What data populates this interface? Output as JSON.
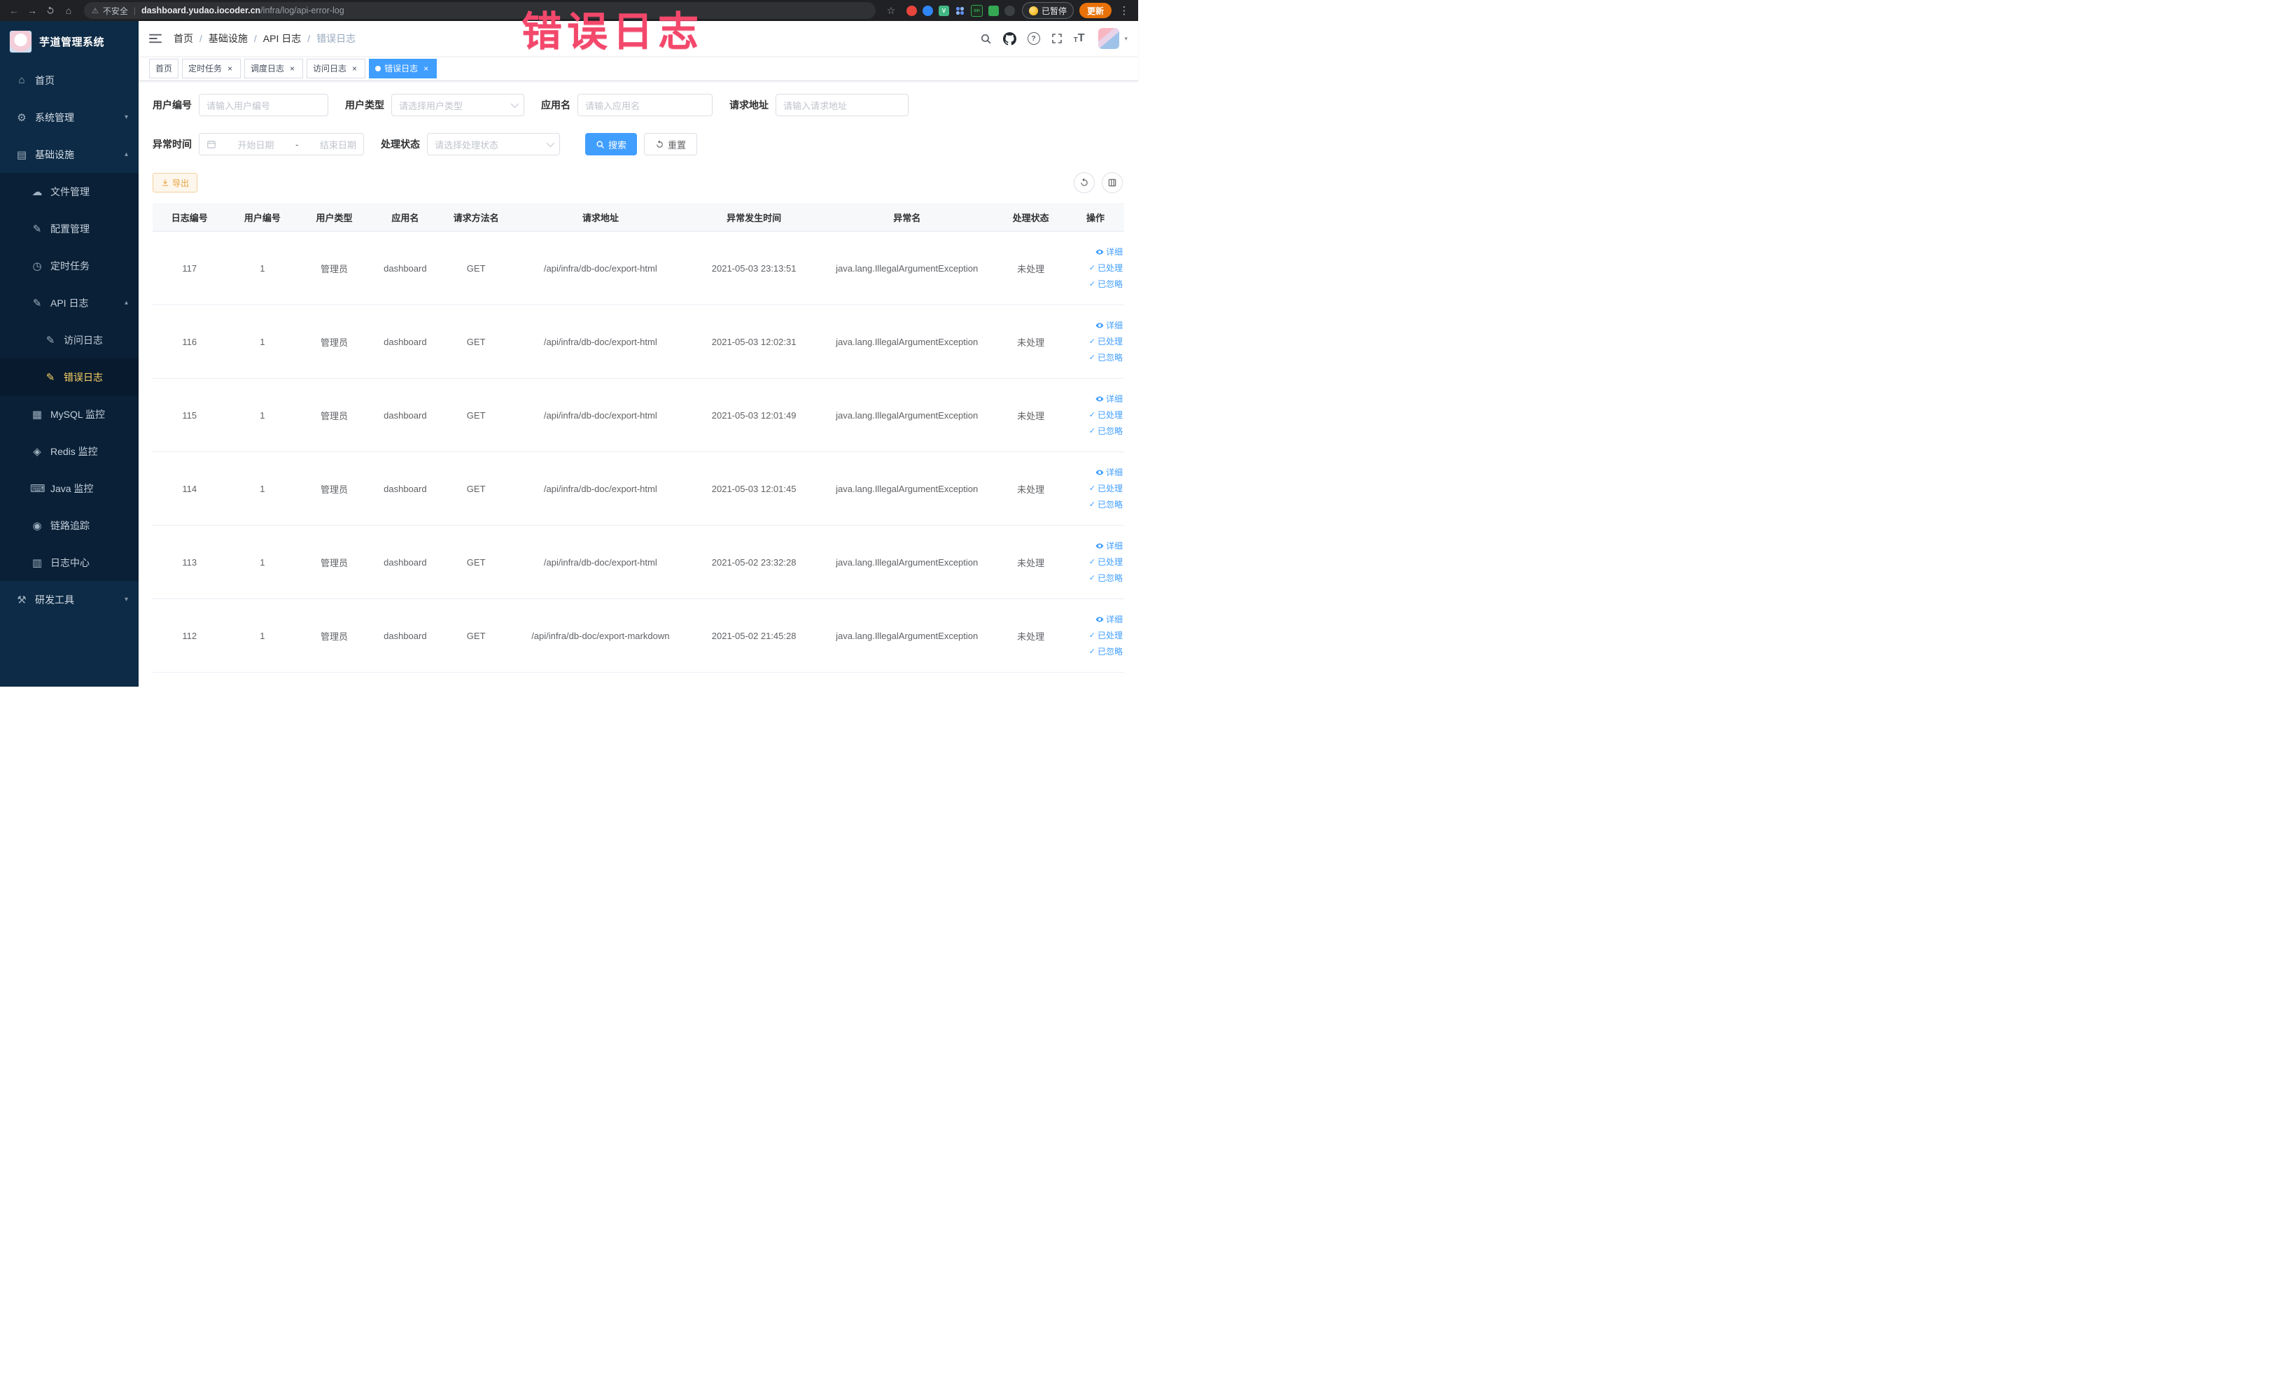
{
  "browser": {
    "security_label": "不安全",
    "url_domain": "dashboard.yudao.iocoder.cn",
    "url_path": "/infra/log/api-error-log",
    "paused_label": "已暂停",
    "update_label": "更新"
  },
  "watermark": "错误日志",
  "sidebar": {
    "logo_title": "芋道管理系统",
    "items": [
      {
        "key": "home",
        "label": "首页",
        "icon": "home-icon",
        "level": 1,
        "type": "item"
      },
      {
        "key": "system-management",
        "label": "系统管理",
        "icon": "gear-icon",
        "level": 1,
        "type": "submenu",
        "state": "collapsed"
      },
      {
        "key": "infrastructure",
        "label": "基础设施",
        "icon": "infra-icon",
        "level": 1,
        "type": "submenu",
        "state": "expanded"
      },
      {
        "key": "file-management",
        "label": "文件管理",
        "icon": "file-manage-icon",
        "level": 2,
        "type": "item"
      },
      {
        "key": "config-management",
        "label": "配置管理",
        "icon": "config-icon",
        "level": 2,
        "type": "item"
      },
      {
        "key": "scheduled-tasks",
        "label": "定时任务",
        "icon": "cron-icon",
        "level": 2,
        "type": "item"
      },
      {
        "key": "api-log",
        "label": "API 日志",
        "icon": "api-log-icon",
        "level": 2,
        "type": "submenu",
        "state": "expanded"
      },
      {
        "key": "access-log",
        "label": "访问日志",
        "icon": "access-log-icon",
        "level": 3,
        "type": "item"
      },
      {
        "key": "error-log",
        "label": "错误日志",
        "icon": "error-log-icon",
        "level": 3,
        "type": "item",
        "active": true
      },
      {
        "key": "mysql-monitor",
        "label": "MySQL 监控",
        "icon": "mysql-icon",
        "level": 2,
        "type": "item"
      },
      {
        "key": "redis-monitor",
        "label": "Redis 监控",
        "icon": "redis-icon",
        "level": 2,
        "type": "item"
      },
      {
        "key": "java-monitor",
        "label": "Java 监控",
        "icon": "java-icon",
        "level": 2,
        "type": "item"
      },
      {
        "key": "link-trace",
        "label": "链路追踪",
        "icon": "trace-icon",
        "level": 2,
        "type": "item"
      },
      {
        "key": "log-center",
        "label": "日志中心",
        "icon": "log-center-icon",
        "level": 2,
        "type": "item"
      },
      {
        "key": "dev-tools",
        "label": "研发工具",
        "icon": "devtools-icon",
        "level": 1,
        "type": "submenu",
        "state": "collapsed"
      }
    ]
  },
  "navbar": {
    "breadcrumb": [
      "首页",
      "基础设施",
      "API 日志",
      "错误日志"
    ]
  },
  "tabs": [
    {
      "key": "home",
      "label": "首页",
      "closable": false,
      "active": false
    },
    {
      "key": "scheduled-tasks",
      "label": "定时任务",
      "closable": true,
      "active": false
    },
    {
      "key": "schedule-log",
      "label": "调度日志",
      "closable": true,
      "active": false
    },
    {
      "key": "access-log",
      "label": "访问日志",
      "closable": true,
      "active": false
    },
    {
      "key": "error-log",
      "label": "错误日志",
      "closable": true,
      "active": true
    }
  ],
  "filters": {
    "user_id": {
      "label": "用户编号",
      "placeholder": "请输入用户编号",
      "value": ""
    },
    "user_type": {
      "label": "用户类型",
      "placeholder": "请选择用户类型",
      "value": ""
    },
    "app_name": {
      "label": "应用名",
      "placeholder": "请输入应用名",
      "value": ""
    },
    "request_url": {
      "label": "请求地址",
      "placeholder": "请输入请求地址",
      "value": ""
    },
    "exception_time": {
      "label": "异常时间",
      "start_placeholder": "开始日期",
      "separator": "-",
      "end_placeholder": "结束日期"
    },
    "process_status": {
      "label": "处理状态",
      "placeholder": "请选择处理状态",
      "value": ""
    },
    "search_label": "搜索",
    "reset_label": "重置"
  },
  "toolbar": {
    "export_label": "导出"
  },
  "table": {
    "columns": [
      "日志编号",
      "用户编号",
      "用户类型",
      "应用名",
      "请求方法名",
      "请求地址",
      "异常发生时间",
      "异常名",
      "处理状态",
      "操作"
    ],
    "action_labels": {
      "detail": "详细",
      "processed": "已处理",
      "ignored": "已忽略"
    },
    "rows": [
      {
        "id": "117",
        "user_id": "1",
        "user_type": "管理员",
        "app": "dashboard",
        "method": "GET",
        "url": "/api/infra/db-doc/export-html",
        "time": "2021-05-03 23:13:51",
        "exception": "java.lang.IllegalArgumentException",
        "status": "未处理"
      },
      {
        "id": "116",
        "user_id": "1",
        "user_type": "管理员",
        "app": "dashboard",
        "method": "GET",
        "url": "/api/infra/db-doc/export-html",
        "time": "2021-05-03 12:02:31",
        "exception": "java.lang.IllegalArgumentException",
        "status": "未处理"
      },
      {
        "id": "115",
        "user_id": "1",
        "user_type": "管理员",
        "app": "dashboard",
        "method": "GET",
        "url": "/api/infra/db-doc/export-html",
        "time": "2021-05-03 12:01:49",
        "exception": "java.lang.IllegalArgumentException",
        "status": "未处理"
      },
      {
        "id": "114",
        "user_id": "1",
        "user_type": "管理员",
        "app": "dashboard",
        "method": "GET",
        "url": "/api/infra/db-doc/export-html",
        "time": "2021-05-03 12:01:45",
        "exception": "java.lang.IllegalArgumentException",
        "status": "未处理"
      },
      {
        "id": "113",
        "user_id": "1",
        "user_type": "管理员",
        "app": "dashboard",
        "method": "GET",
        "url": "/api/infra/db-doc/export-html",
        "time": "2021-05-02 23:32:28",
        "exception": "java.lang.IllegalArgumentException",
        "status": "未处理"
      },
      {
        "id": "112",
        "user_id": "1",
        "user_type": "管理员",
        "app": "dashboard",
        "method": "GET",
        "url": "/api/infra/db-doc/export-markdown",
        "time": "2021-05-02 21:45:28",
        "exception": "java.lang.IllegalArgumentException",
        "status": "未处理"
      }
    ]
  },
  "icons": {
    "home-icon": "⌂",
    "gear-icon": "⚙",
    "infra-icon": "▤",
    "file-manage-icon": "☁",
    "config-icon": "✎",
    "cron-icon": "◷",
    "api-log-icon": "✎",
    "access-log-icon": "✎",
    "error-log-icon": "✎",
    "mysql-icon": "▦",
    "redis-icon": "◈",
    "java-icon": "⌨",
    "trace-icon": "◉",
    "log-center-icon": "▥",
    "devtools-icon": "⚒",
    "chevron-up-icon": "▴",
    "chevron-down-icon": "▾",
    "caret-down-icon": "▾",
    "back-icon": "←",
    "forward-icon": "→",
    "browser-home-icon": "⌂",
    "star-icon": "☆",
    "warning-icon": "⚠",
    "more-icon": "⋮",
    "check-icon": "✓",
    "close-icon": "×"
  },
  "colors": {
    "primary": "#409eff",
    "link": "#409eff",
    "sidebar_bg": "#0d2b46",
    "submenu_bg": "#092036",
    "active_menu_text": "#ffd666",
    "warning": "#e6a23c",
    "watermark": "#f3486b",
    "tag_active_bg": "#409eff",
    "update_button": "#e8710a"
  }
}
